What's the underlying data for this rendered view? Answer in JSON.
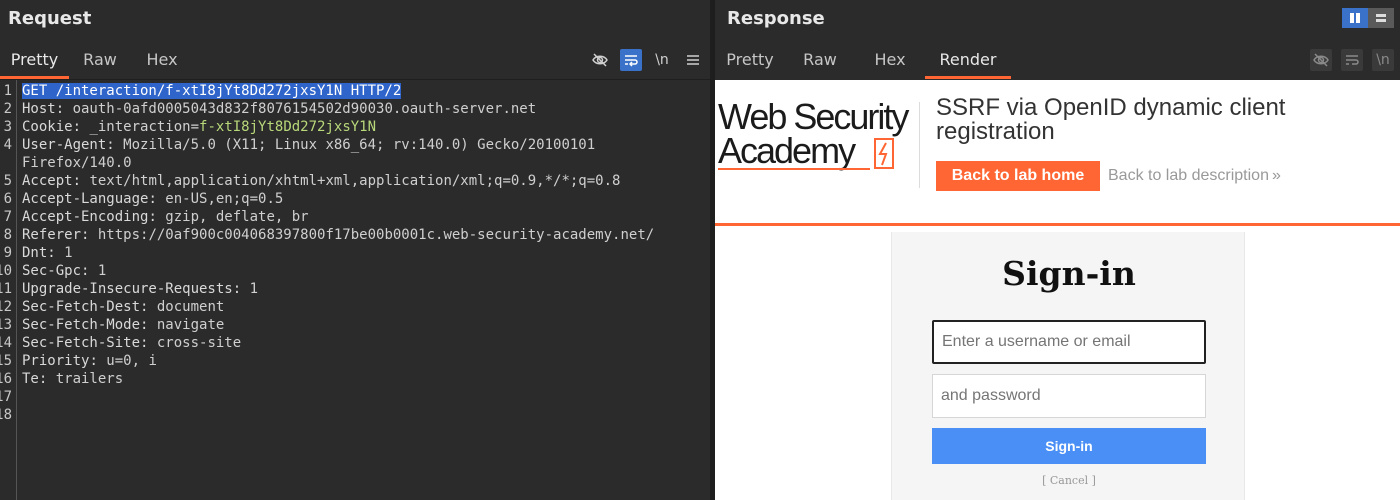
{
  "request": {
    "title": "Request",
    "tabs": [
      "Pretty",
      "Raw",
      "Hex"
    ],
    "active_tab": "Pretty",
    "toolbar": {
      "hide_icon": "eye-off-icon",
      "wrap_icon": "wrap-icon",
      "newline_label": "\\n",
      "menu_icon": "hamburger-icon"
    },
    "line_numbers": [
      "1",
      "2",
      "3",
      "4",
      "",
      "5",
      "6",
      "7",
      "8",
      "9",
      "10",
      "11",
      "12",
      "13",
      "14",
      "15",
      "16",
      "17",
      "18"
    ],
    "lines": [
      {
        "key": "GET /interaction/f-xtI8jYt8Dd272jxsY1N HTTP/2",
        "sep": "",
        "val": ""
      },
      {
        "key": "Host",
        "sep": ": ",
        "val": "oauth-0afd0005043d832f8076154502d90030.oauth-server.net"
      },
      {
        "key": "Cookie",
        "sep": ": ",
        "cookie_name": "_interaction",
        "cookie_eq": "=",
        "val": "f-xtI8jYt8Dd272jxsY1N"
      },
      {
        "key": "User-Agent",
        "sep": ": ",
        "val": "Mozilla/5.0 (X11; Linux x86_64; rv:140.0) Gecko/20100101"
      },
      {
        "key": "",
        "sep": "",
        "val": "Firefox/140.0"
      },
      {
        "key": "Accept",
        "sep": ": ",
        "val": "text/html,application/xhtml+xml,application/xml;q=0.9,*/*;q=0.8"
      },
      {
        "key": "Accept-Language",
        "sep": ": ",
        "val": "en-US,en;q=0.5"
      },
      {
        "key": "Accept-Encoding",
        "sep": ": ",
        "val": "gzip, deflate, br"
      },
      {
        "key": "Referer",
        "sep": ": ",
        "val": "https://0af900c004068397800f17be00b0001c.web-security-academy.net/"
      },
      {
        "key": "Dnt",
        "sep": ": ",
        "val": "1"
      },
      {
        "key": "Sec-Gpc",
        "sep": ": ",
        "val": "1"
      },
      {
        "key": "Upgrade-Insecure-Requests",
        "sep": ": ",
        "val": "1"
      },
      {
        "key": "Sec-Fetch-Dest",
        "sep": ": ",
        "val": "document"
      },
      {
        "key": "Sec-Fetch-Mode",
        "sep": ": ",
        "val": "navigate"
      },
      {
        "key": "Sec-Fetch-Site",
        "sep": ": ",
        "val": "cross-site"
      },
      {
        "key": "Priority",
        "sep": ": ",
        "val": "u=0, i"
      },
      {
        "key": "Te",
        "sep": ": ",
        "val": "trailers"
      },
      {
        "key": "",
        "sep": "",
        "val": ""
      },
      {
        "key": "",
        "sep": "",
        "val": ""
      }
    ]
  },
  "response": {
    "title": "Response",
    "tabs": [
      "Pretty",
      "Raw",
      "Hex",
      "Render"
    ],
    "active_tab": "Render",
    "layout_icons": [
      "split-columns-icon",
      "split-rows-icon"
    ],
    "toolbar": {
      "hide_icon": "eye-off-icon",
      "wrap_icon": "wrap-icon",
      "newline_label": "\\n"
    },
    "render": {
      "logo_line1": "Web Security",
      "logo_line2": "Academy",
      "lab_title": "SSRF via OpenID dynamic client registration",
      "back_home": "Back to lab home",
      "back_desc": "Back to lab description",
      "desc_chevron": "»",
      "signin_title": "Sign-in",
      "username_placeholder": "Enter a username or email",
      "password_placeholder": "and password",
      "signin_button": "Sign-in",
      "cancel": "[ Cancel ]"
    }
  },
  "colors": {
    "accent": "#ff6633",
    "selection": "#2f65ca",
    "cookie_value": "#b8d87a",
    "signin_blue": "#4a8ff5"
  }
}
